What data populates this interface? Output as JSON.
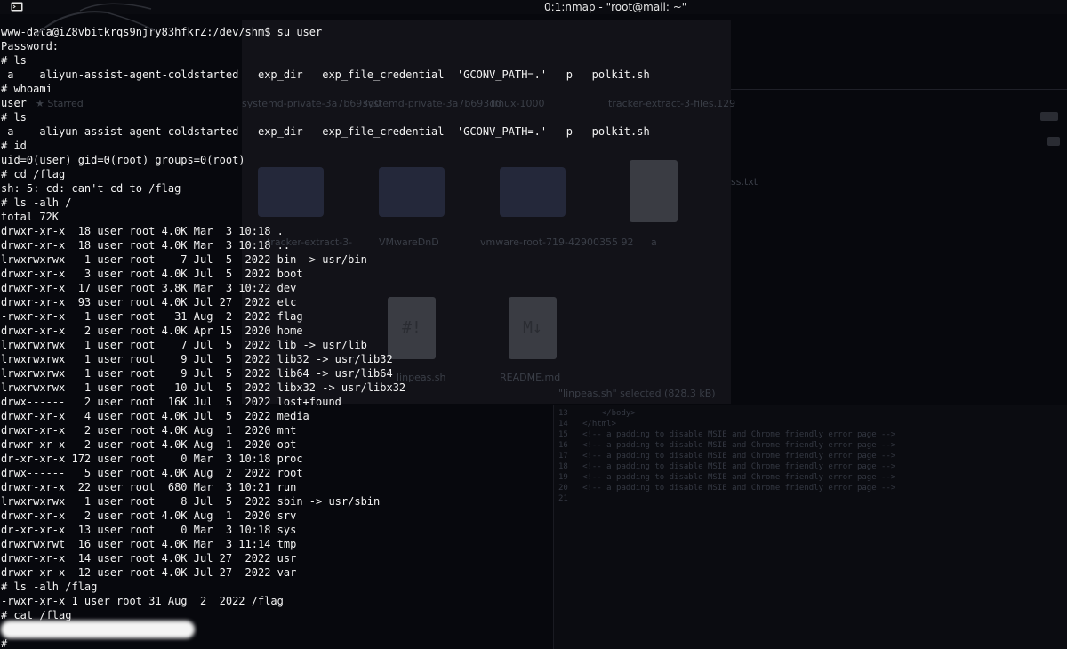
{
  "titlebar": {
    "title": "0:1:nmap - \"root@mail: ~\"",
    "icon": "terminal-app-icon"
  },
  "background": {
    "sidebar_label": "★ Starred",
    "icon_labels": [
      "systemd-private-3a7b693d0",
      "systemd-private-3a7b693d0",
      "tmux-1000",
      "tracker-extract-3-files.129",
      "tracker-extract-3-",
      "VMwareDnD",
      "vmware-root-719-42900355 92",
      "a",
      "linpeas.sh",
      "README.md"
    ],
    "status": "\"linpeas.sh\" selected (828.3 kB)",
    "code_lines": [
      "13       </body>",
      "14   </html>",
      "15   <!-- a padding to disable MSIE and Chrome friendly error page -->",
      "16   <!-- a padding to disable MSIE and Chrome friendly error page -->",
      "17   <!-- a padding to disable MSIE and Chrome friendly error page -->",
      "18   <!-- a padding to disable MSIE and Chrome friendly error page -->",
      "19   <!-- a padding to disable MSIE and Chrome friendly error page -->",
      "20   <!-- a padding to disable MSIE and Chrome friendly error page -->",
      "21"
    ],
    "right_text": "ss.txt"
  },
  "terminal": {
    "lines": [
      "www-data@iZ8vbitkrqs9njry83hfkrZ:/dev/shm$ su user",
      "Password:",
      "# ls",
      " a    aliyun-assist-agent-coldstarted   exp_dir   exp_file_credential  'GCONV_PATH=.'   p   polkit.sh",
      "# whoami",
      "user",
      "# ls",
      " a    aliyun-assist-agent-coldstarted   exp_dir   exp_file_credential  'GCONV_PATH=.'   p   polkit.sh",
      "# id",
      "uid=0(user) gid=0(root) groups=0(root)",
      "# cd /flag",
      "sh: 5: cd: can't cd to /flag",
      "# ls -alh /",
      "total 72K",
      "drwxr-xr-x  18 user root 4.0K Mar  3 10:18 .",
      "drwxr-xr-x  18 user root 4.0K Mar  3 10:18 ..",
      "lrwxrwxrwx   1 user root    7 Jul  5  2022 bin -> usr/bin",
      "drwxr-xr-x   3 user root 4.0K Jul  5  2022 boot",
      "drwxr-xr-x  17 user root 3.8K Mar  3 10:22 dev",
      "drwxr-xr-x  93 user root 4.0K Jul 27  2022 etc",
      "-rwxr-xr-x   1 user root   31 Aug  2  2022 flag",
      "drwxr-xr-x   2 user root 4.0K Apr 15  2020 home",
      "lrwxrwxrwx   1 user root    7 Jul  5  2022 lib -> usr/lib",
      "lrwxrwxrwx   1 user root    9 Jul  5  2022 lib32 -> usr/lib32",
      "lrwxrwxrwx   1 user root    9 Jul  5  2022 lib64 -> usr/lib64",
      "lrwxrwxrwx   1 user root   10 Jul  5  2022 libx32 -> usr/libx32",
      "drwx------   2 user root  16K Jul  5  2022 lost+found",
      "drwxr-xr-x   4 user root 4.0K Jul  5  2022 media",
      "drwxr-xr-x   2 user root 4.0K Aug  1  2020 mnt",
      "drwxr-xr-x   2 user root 4.0K Aug  1  2020 opt",
      "dr-xr-xr-x 172 user root    0 Mar  3 10:18 proc",
      "drwx------   5 user root 4.0K Aug  2  2022 root",
      "drwxr-xr-x  22 user root  680 Mar  3 10:21 run",
      "lrwxrwxrwx   1 user root    8 Jul  5  2022 sbin -> usr/sbin",
      "drwxr-xr-x   2 user root 4.0K Aug  1  2020 srv",
      "dr-xr-xr-x  13 user root    0 Mar  3 10:18 sys",
      "drwxrwxrwt  16 user root 4.0K Mar  3 11:14 tmp",
      "drwxr-xr-x  14 user root 4.0K Jul 27  2022 usr",
      "drwxr-xr-x  12 user root 4.0K Jul 27  2022 var",
      "# ls -alh /flag",
      "-rwxr-xr-x 1 user root 31 Aug  2  2022 /flag",
      "# cat /flag"
    ],
    "last_prompt": "#"
  }
}
